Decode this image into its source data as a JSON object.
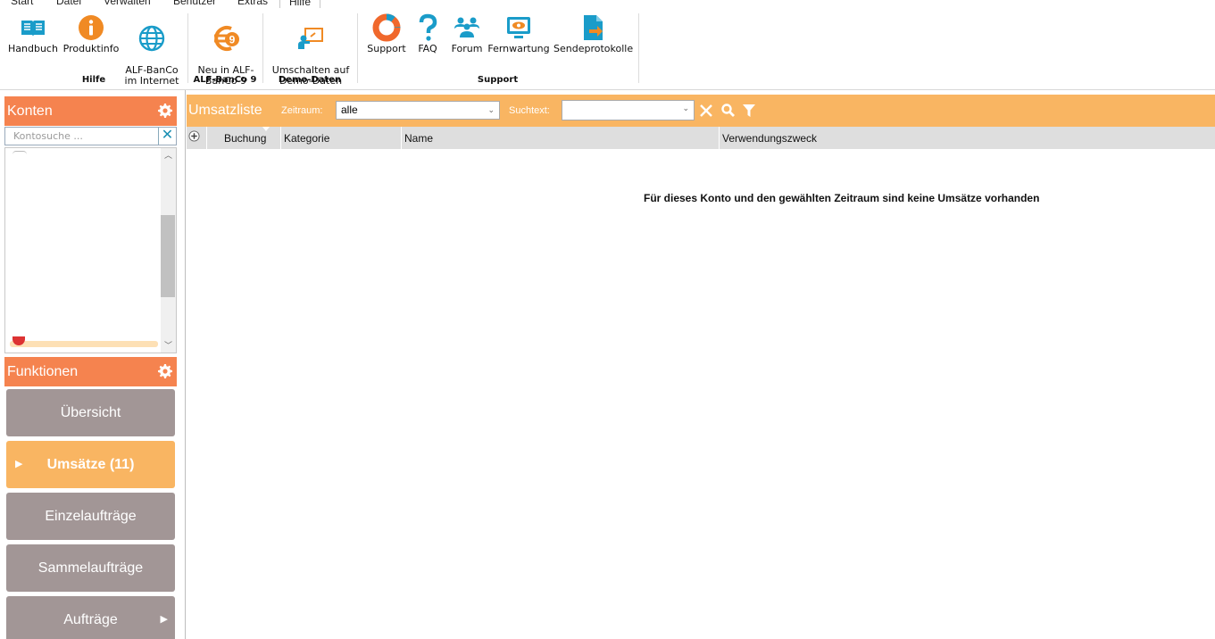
{
  "menu": {
    "tabs": [
      "Start",
      "Datei",
      "Verwalten",
      "Benutzer",
      "Extras",
      "Hilfe"
    ],
    "active": "Hilfe"
  },
  "ribbon": {
    "buttons": [
      {
        "label": "Handbuch",
        "icon": "book-icon"
      },
      {
        "label": "Produktinfo",
        "icon": "info-icon"
      },
      {
        "label": "ALF-BanCo\nim Internet",
        "icon": "globe-icon"
      },
      {
        "label": "Neu in ALF-\nBanCo 9",
        "icon": "euro-nine-icon"
      },
      {
        "label": "Umschalten auf\nDemo-Daten",
        "icon": "presentation-icon"
      },
      {
        "label": "Support",
        "icon": "lifebuoy-icon"
      },
      {
        "label": "FAQ",
        "icon": "question-icon"
      },
      {
        "label": "Forum",
        "icon": "people-icon"
      },
      {
        "label": "Fernwartung",
        "icon": "remote-screen-icon"
      },
      {
        "label": "Sendeprotokolle",
        "icon": "document-export-icon"
      }
    ],
    "groups": [
      "Hilfe",
      "ALF-BanCo 9",
      "Demo-Daten",
      "Support"
    ]
  },
  "konten": {
    "title": "Konten",
    "search_placeholder": "Kontosuche ..."
  },
  "funktionen": {
    "title": "Funktionen",
    "items": [
      {
        "label": "Übersicht"
      },
      {
        "label": "Umsätze (11)"
      },
      {
        "label": "Einzelaufträge"
      },
      {
        "label": "Sammelaufträge"
      },
      {
        "label": "Aufträge"
      }
    ]
  },
  "main": {
    "title": "Umsatzliste",
    "zeitraum_label": "Zeitraum:",
    "zeitraum_value": "alle",
    "suchtext_label": "Suchtext:",
    "suchtext_value": "",
    "columns": [
      "Buchung",
      "Kategorie",
      "Name",
      "Verwendungszweck"
    ],
    "empty_message": "Für dieses Konto und den gewählten Zeitraum sind keine Umsätze vorhanden"
  },
  "colors": {
    "panel_header": "#f5834f",
    "main_header": "#f9b562",
    "function_button": "#a29696",
    "function_button_active": "#f9b562",
    "icon_blue": "#1a9cc9",
    "icon_orange": "#f08a24"
  }
}
